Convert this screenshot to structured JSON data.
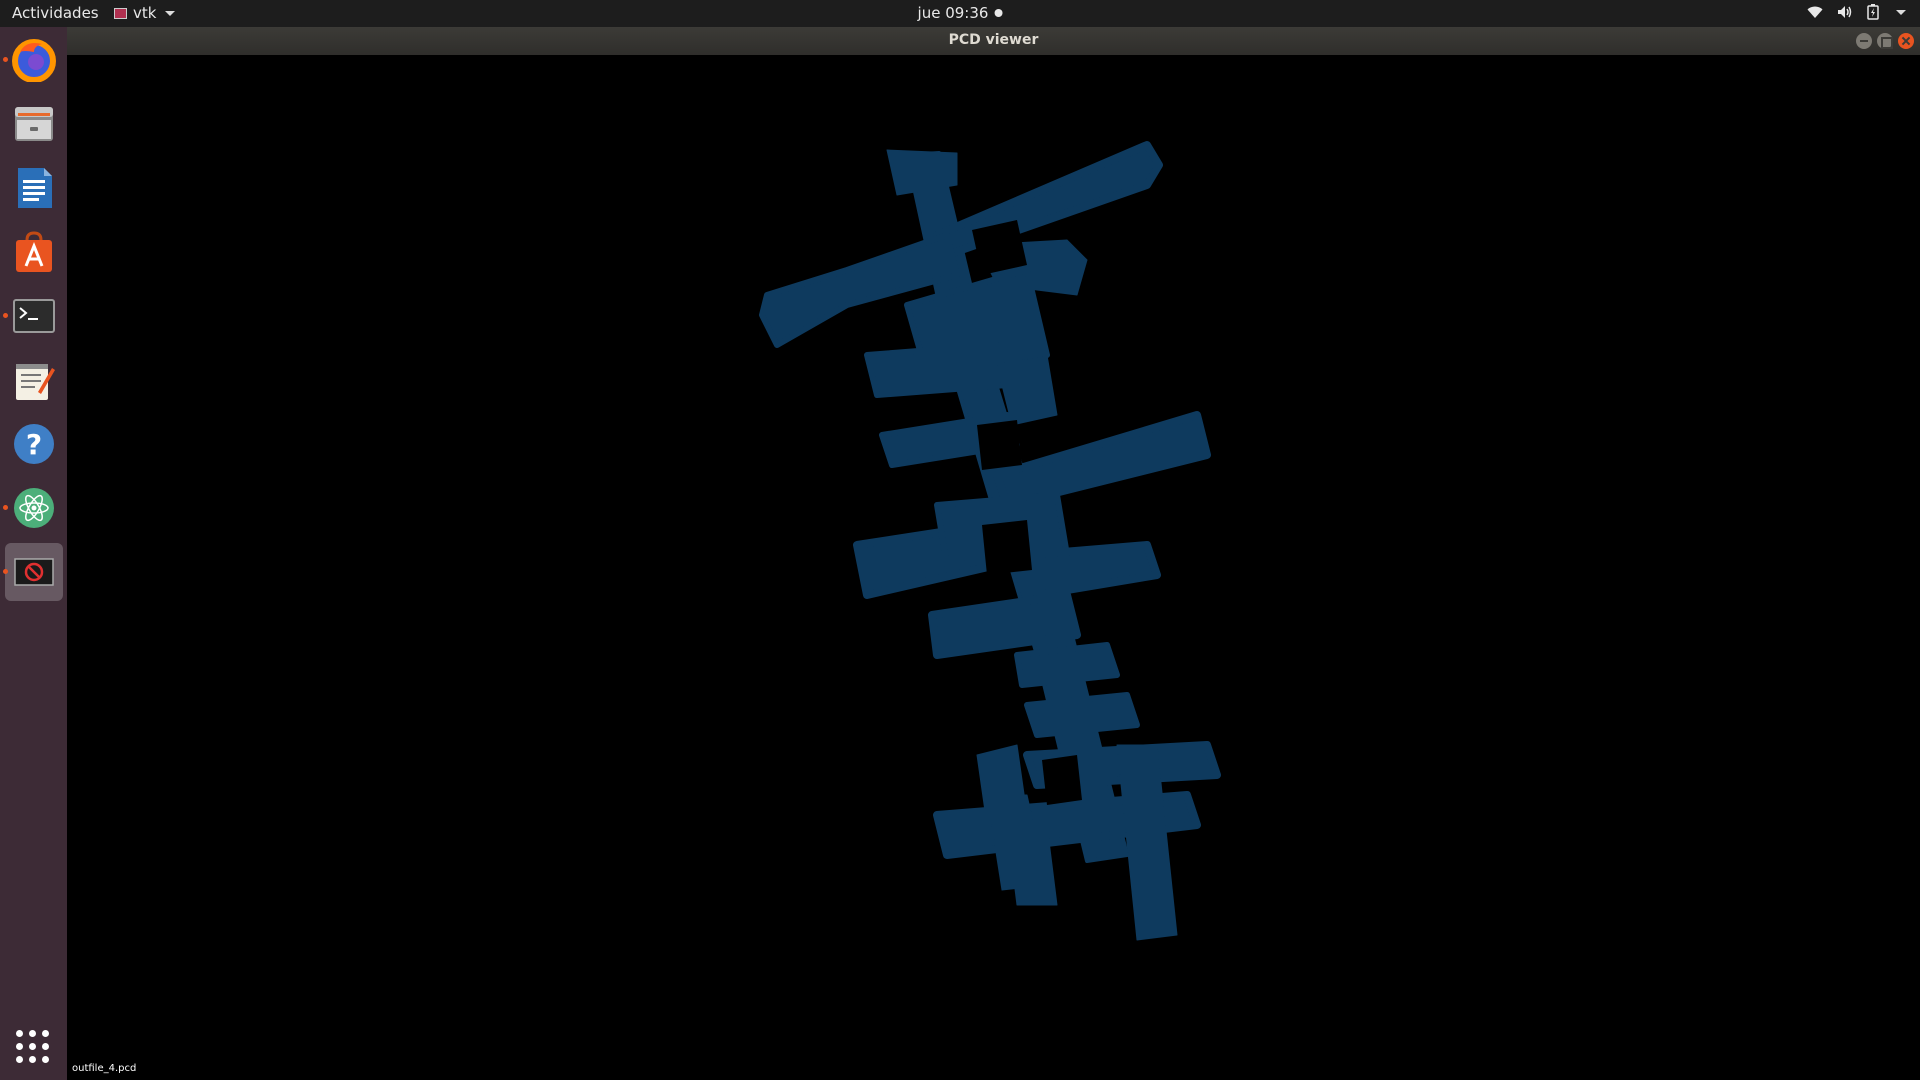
{
  "topbar": {
    "activities_label": "Actividades",
    "app_menu_label": "vtk",
    "clock": "jue 09:36",
    "tray_icons": [
      "wifi-icon",
      "volume-icon",
      "battery-icon",
      "system-menu-caret-icon"
    ]
  },
  "dock": {
    "items": [
      {
        "name": "firefox",
        "icon": "firefox-icon",
        "running": true
      },
      {
        "name": "files",
        "icon": "files-icon",
        "running": false
      },
      {
        "name": "writer",
        "icon": "writer-icon",
        "running": false
      },
      {
        "name": "software",
        "icon": "software-icon",
        "running": false
      },
      {
        "name": "terminal",
        "icon": "terminal-icon",
        "running": true
      },
      {
        "name": "text-editor",
        "icon": "text-editor-icon",
        "running": false
      },
      {
        "name": "help",
        "icon": "help-icon",
        "running": false
      },
      {
        "name": "atom",
        "icon": "atom-icon",
        "running": true
      },
      {
        "name": "pcd-viewer",
        "icon": "vtk-window-icon",
        "running": true,
        "active": true
      }
    ],
    "show_apps_icon": "app-grid-icon"
  },
  "window": {
    "title": "PCD viewer",
    "buttons": [
      "minimize",
      "maximize",
      "close"
    ],
    "background": "#000000",
    "point_color": "#0e3a5e",
    "filename": "outfile_4.pcd"
  },
  "colors": {
    "topbar_bg": "#1d1d1d",
    "dock_bg": "#3d2b36",
    "accent": "#e95420"
  }
}
